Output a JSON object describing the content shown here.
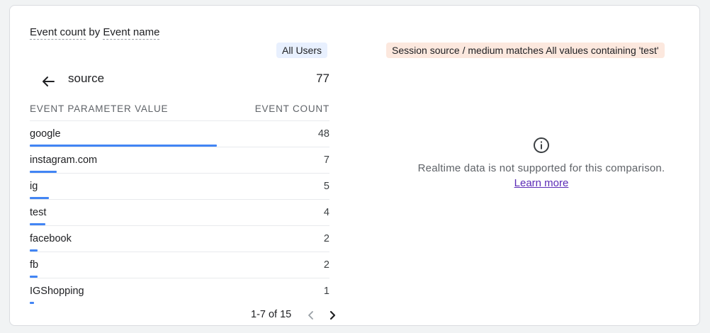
{
  "card": {
    "title_part1": "Event count",
    "title_part2": "by",
    "title_part3": "Event name"
  },
  "segments": {
    "all_users": "All Users",
    "comparison": "Session source / medium matches All values containing 'test'"
  },
  "drilldown": {
    "dimension": "source",
    "total": "77"
  },
  "table": {
    "col_left": "EVENT PARAMETER VALUE",
    "col_right": "EVENT COUNT",
    "rows": [
      {
        "label": "google",
        "value": "48",
        "share": 0.625
      },
      {
        "label": "instagram.com",
        "value": "7",
        "share": 0.091
      },
      {
        "label": "ig",
        "value": "5",
        "share": 0.065
      },
      {
        "label": "test",
        "value": "4",
        "share": 0.052
      },
      {
        "label": "facebook",
        "value": "2",
        "share": 0.026
      },
      {
        "label": "fb",
        "value": "2",
        "share": 0.026
      },
      {
        "label": "IGShopping",
        "value": "1",
        "share": 0.013
      }
    ]
  },
  "pager": {
    "text": "1-7 of 15"
  },
  "notice": {
    "message": "Realtime data is not supported for this comparison.",
    "link": "Learn more"
  },
  "colors": {
    "bar": "#4285f4",
    "chip_users": "#e8f0fe",
    "chip_comparison": "#fce8de",
    "link": "#5b2bb6"
  },
  "icons": {
    "back": "arrow-left-icon",
    "info": "info-icon",
    "prev": "chevron-left-icon",
    "next": "chevron-right-icon"
  }
}
